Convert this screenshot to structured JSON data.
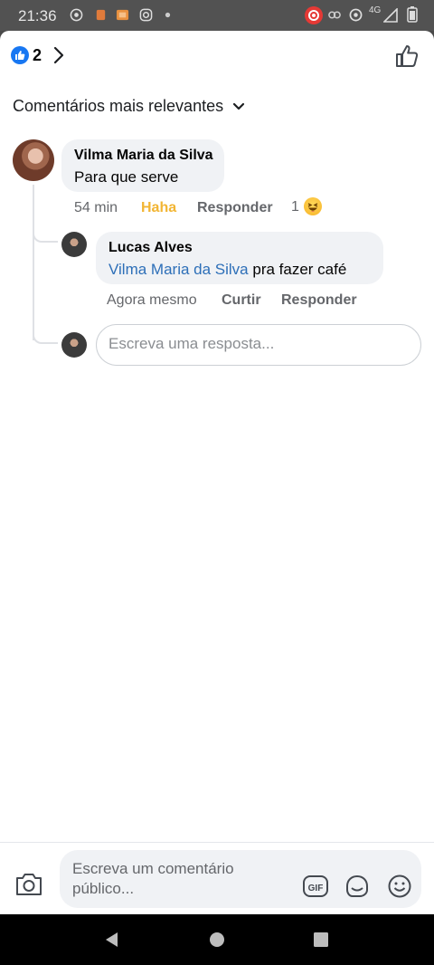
{
  "status_bar": {
    "time": "21:36",
    "network": "4G"
  },
  "header": {
    "like_count": "2"
  },
  "sort": {
    "label": "Comentários mais relevantes"
  },
  "comments": {
    "main": {
      "author": "Vilma Maria da Silva",
      "text": "Para que serve",
      "time": "54 min",
      "reaction_label": "Haha",
      "reply_label": "Responder",
      "reaction_count": "1"
    },
    "reply": {
      "author": "Lucas Alves",
      "mention": "Vilma Maria da Silva",
      "text": " pra fazer café",
      "time": "Agora mesmo",
      "like_label": "Curtir",
      "reply_label": "Responder"
    }
  },
  "reply_input": {
    "placeholder": "Escreva uma resposta..."
  },
  "composer": {
    "placeholder": "Escreva um comentário público..."
  },
  "colors": {
    "accent": "#1877f2",
    "haha": "#f2b533",
    "mention": "#2d6fb8"
  }
}
